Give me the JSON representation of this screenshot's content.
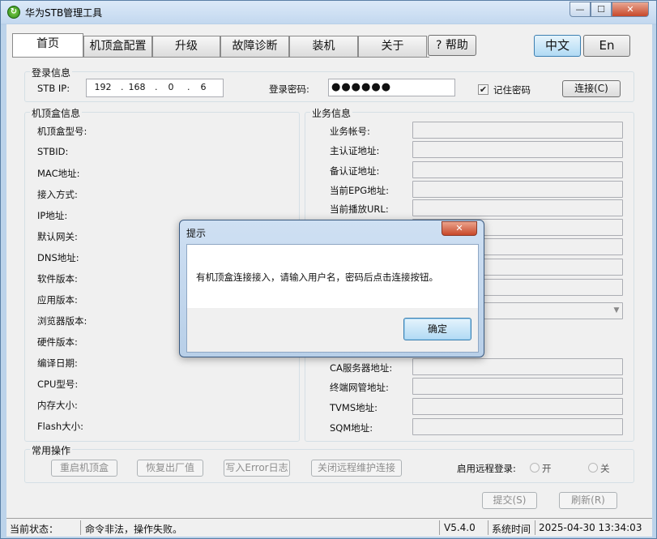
{
  "window": {
    "title": "华为STB管理工具",
    "min": "—",
    "max": "☐",
    "close": "✕",
    "app_icon": "refresh-icon"
  },
  "tabs": [
    {
      "label": "首页"
    },
    {
      "label": "机顶盒配置"
    },
    {
      "label": "升级"
    },
    {
      "label": "故障诊断"
    },
    {
      "label": "装机"
    },
    {
      "label": "关于"
    }
  ],
  "help": "? 帮助",
  "lang": {
    "zh": "中文",
    "en": "En"
  },
  "login": {
    "group": "登录信息",
    "ip_label": "STB IP:",
    "ip": [
      "192",
      "168",
      "0",
      "6"
    ],
    "password_label": "登录密码:",
    "password_mask": "●●●●●●",
    "remember_label": "记住密码",
    "remember_checked": "✔",
    "connect_button": "连接(C)"
  },
  "stb_info": {
    "group": "机顶盒信息",
    "labels": [
      "机顶盒型号:",
      "STBID:",
      "MAC地址:",
      "接入方式:",
      "IP地址:",
      "默认网关:",
      "DNS地址:",
      "软件版本:",
      "应用版本:",
      "浏览器版本:",
      "硬件版本:",
      "编译日期:",
      "CPU型号:",
      "内存大小:",
      "Flash大小:"
    ]
  },
  "service_info": {
    "group": "业务信息",
    "labels": [
      "业务帐号:",
      "主认证地址:",
      "备认证地址:",
      "当前EPG地址:",
      "当前播放URL:",
      "CA服务器地址:",
      "终端网管地址:",
      "TVMS地址:",
      "SQM地址:"
    ]
  },
  "ops": {
    "group": "常用操作",
    "reboot": "重启机顶盒",
    "factory_reset": "恢复出厂值",
    "write_error_log": "写入Error日志",
    "close_remote": "关闭远程维护连接",
    "remote_login_label": "启用远程登录:",
    "on": "开",
    "off": "关"
  },
  "footer_buttons": {
    "submit": "提交(S)",
    "refresh": "刷新(R)"
  },
  "status": {
    "label": "当前状态：",
    "message": "命令非法，操作失败。",
    "version": "V5.4.0",
    "time_label": "系统时间",
    "time": "2025-04-30 13:34:03"
  },
  "dialog": {
    "title": "提示",
    "message": "有机顶盒连接接入，请输入用户名，密码后点击连接按钮。",
    "ok": "确定",
    "close": "✕"
  }
}
